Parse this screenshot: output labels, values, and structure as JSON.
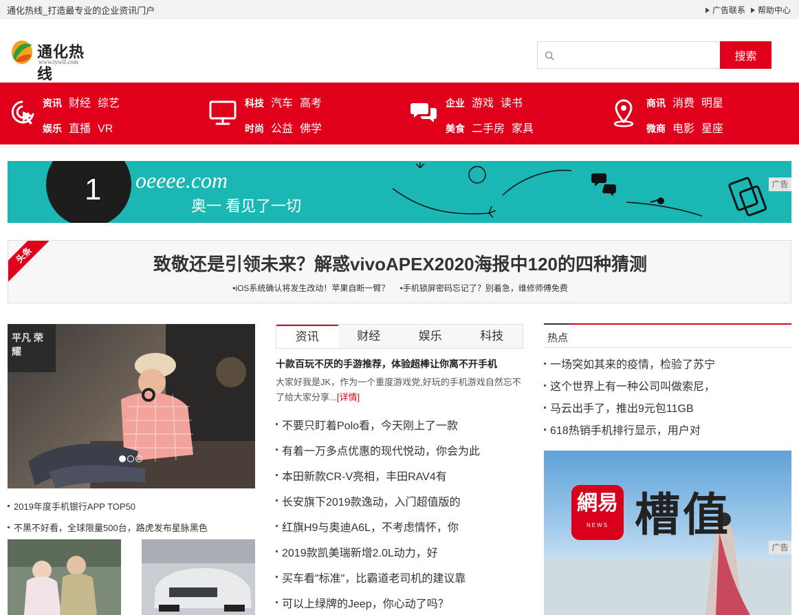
{
  "topbar": {
    "site_tag": "通化热线_打造最专业的企业资讯门户",
    "links": [
      "广告联系",
      "帮助中心"
    ]
  },
  "logo": {
    "name": "通化热线",
    "url": "www.tywlf.com"
  },
  "search": {
    "placeholder": "",
    "button": "搜索"
  },
  "nav": [
    {
      "icon": "cursor-click-icon",
      "row1": {
        "lead": "资讯",
        "items": [
          "财经",
          "综艺"
        ]
      },
      "row2": {
        "lead": "娱乐",
        "items": [
          "直播",
          "VR"
        ]
      }
    },
    {
      "icon": "monitor-icon",
      "row1": {
        "lead": "科技",
        "items": [
          "汽车",
          "高考"
        ]
      },
      "row2": {
        "lead": "时尚",
        "items": [
          "公益",
          "佛学"
        ]
      }
    },
    {
      "icon": "chat-bubbles-icon",
      "row1": {
        "lead": "企业",
        "items": [
          "游戏",
          "读书"
        ]
      },
      "row2": {
        "lead": "美食",
        "items": [
          "二手房",
          "家具"
        ]
      }
    },
    {
      "icon": "map-pin-icon",
      "row1": {
        "lead": "商讯",
        "items": [
          "消费",
          "明星"
        ]
      },
      "row2": {
        "lead": "微商",
        "items": [
          "电影",
          "星座"
        ]
      }
    }
  ],
  "banner": {
    "brand": "oeeee.com",
    "slogan": "奥一 看见了一切",
    "ad_tag": "广告"
  },
  "headline": {
    "ribbon": "头条",
    "title": "致敬还是引领未来？解惑vivoAPEX2020海报中120的四种猜测",
    "subs": [
      "•iOS系统确认将发生改动！苹果自断一臂？",
      "•手机锁屏密码忘记了？别着急，维修师傅免费"
    ]
  },
  "slide": {
    "poster_text": "平凡 荣耀",
    "dots": 3,
    "active_dot": 0
  },
  "left_list": [
    "2019年度手机银行APP TOP50",
    "不黑不好看，全球限量500台，路虎发布星脉黑色"
  ],
  "tabs": [
    {
      "label": "资讯",
      "active": true
    },
    {
      "label": "财经",
      "active": false
    },
    {
      "label": "娱乐",
      "active": false
    },
    {
      "label": "科技",
      "active": false
    }
  ],
  "feature": {
    "title": "十款百玩不厌的手游推荐，体验超棒让你离不开手机",
    "desc": "大家好我是JK，作为一个重度游戏党,好玩的手机游戏自然忘不了给大家分享...",
    "more": "[详情]"
  },
  "mid_list": [
    "不要只盯着Polo看，今天刚上了一款",
    "有着一万多点优惠的现代悦动，你会为此",
    "本田新款CR-V亮相，丰田RAV4有",
    "长安旗下2019款逸动，入门超值版的",
    "红旗H9与奥迪A6L，不考虑情怀，你",
    "2019款凯美瑞新增2.0L动力，好",
    "买车看\"标准\"，比霸道老司机的建议靠",
    "可以上绿牌的Jeep，你心动了吗？"
  ],
  "hot": {
    "label": "热点",
    "items": [
      "一场突如其来的疫情，检验了苏宁",
      "这个世界上有一种公司叫做索尼，",
      "马云出手了，推出9元包11GB",
      "618热销手机排行显示，用户对"
    ]
  },
  "side_ad": {
    "logo_text": "網易",
    "logo_sub": "NEWS",
    "name": "槽值",
    "ad_tag": "广告"
  },
  "colors": {
    "brand_red": "#e0001b",
    "banner_teal": "#1ab7b5"
  }
}
